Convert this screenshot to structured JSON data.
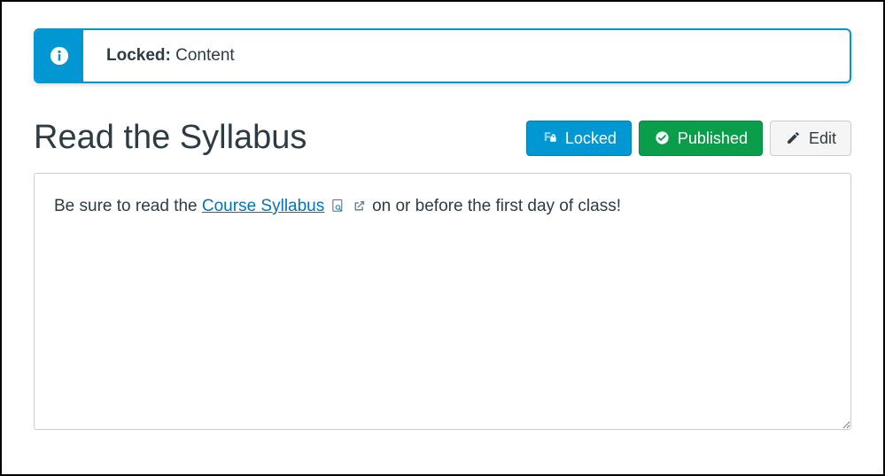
{
  "alert": {
    "label": "Locked:",
    "value": "Content"
  },
  "page_title": "Read the Syllabus",
  "buttons": {
    "locked": "Locked",
    "published": "Published",
    "edit": "Edit"
  },
  "content": {
    "before_link": "Be sure to read the ",
    "link_text": "Course Syllabus",
    "after_link": " on or before the first day of class!"
  },
  "icons": {
    "info": "info-icon",
    "blueprint_lock": "blueprint-lock-icon",
    "published_check": "check-circle-icon",
    "edit_pencil": "pencil-icon",
    "file_preview": "file-preview-icon",
    "external_link": "external-link-icon"
  },
  "colors": {
    "accent_blue": "#0097d3",
    "green": "#0b9e4a",
    "link": "#0374b5",
    "text": "#2d3b45"
  }
}
